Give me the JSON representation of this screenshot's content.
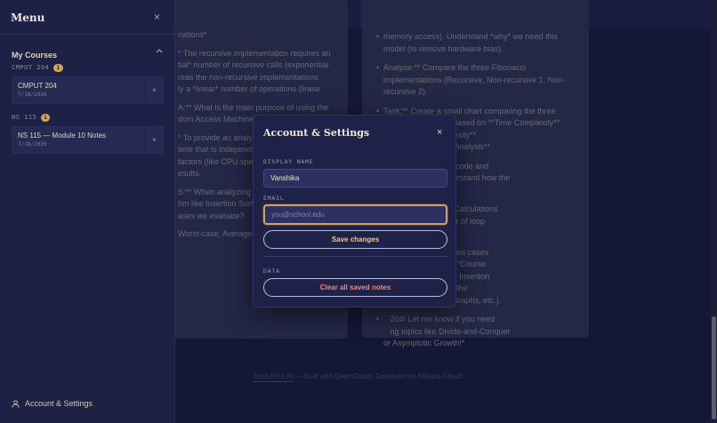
{
  "background": {
    "left_card_paragraphs": [
      "nations*",
      "* The recursive implementation requires an\ntial* number of recursive calls (exponential\nreas the non-recursive implementations\nly a *linear* number of operations (linear",
      "A:** What is the main purpose of using the\ndom Access Machine",
      "* To provide an analy\ntime that is independe\nfactors (like CPU spee\nesults.",
      "S:** When analyzing th\nhm like Insertion Sort,\nases we evaluate?",
      "Worst-case, Average"
    ],
    "right_card_items": [
      "memory access). Understand *why* we need this\nmodel (to remove hardware bias).",
      "Analyze:** Compare the three Fibonacci\nimplementations (Recursive, Non-recursive 1, Non-\nrecursive 2).",
      "Task:** Create a small chart comparing the three\nFibonacci methods based on **Time Complexity**\nand **Space Complexity**\n      s Running Time Analysis**",
      "   ertion Sort pseudocode and\n   ace\" slides to understand how the\n   ements.",
      "   e \"Let's Do Some Calculations\n   nd how the number of loop\n   lculated.",
      "   the three RT analysis cases\n   , briefly look at the \"Course\n   ginning to see how Insertion\n   e bigger picture of the\n   de-and-Conquer, Graphs, etc.).",
      "   204! Let me know if you need\n   ng topics like Divide-and-Conquer\nor Asymptotic Growth!*"
    ],
    "footer_brand": "StudyPilot AI",
    "footer_rest": " — Built with QwenCloud. Deployed on Alibaba Cloud."
  },
  "sidebar": {
    "title": "Menu",
    "close_glyph": "×",
    "section_title": "My Courses",
    "collapse_glyph": "⌃",
    "courses": [
      {
        "code": "CMPUT 204",
        "count": "1",
        "notes": [
          {
            "title": "CMPUT 204",
            "date": "7/18/2026",
            "delete_glyph": "×"
          }
        ]
      },
      {
        "code": "NS 115",
        "count": "1",
        "notes": [
          {
            "title": "NS 115 — Module 10 Notes",
            "date": "7/18/2026",
            "delete_glyph": "×"
          }
        ]
      }
    ],
    "settings_label": "Account & Settings",
    "settings_icon": "user-icon"
  },
  "modal": {
    "title": "Account & Settings",
    "close_glyph": "×",
    "display_name_label": "DISPLAY NAME",
    "display_name_value": "Vanshika",
    "email_label": "EMAIL",
    "email_value": "",
    "email_placeholder": "you@school.edu",
    "save_label": "Save changes",
    "data_label": "DATA",
    "clear_label": "Clear all saved notes"
  },
  "colors": {
    "accent": "#d2a15c",
    "danger": "#f08a75",
    "panel": "#1e2249",
    "sidebar": "#1d2146"
  }
}
